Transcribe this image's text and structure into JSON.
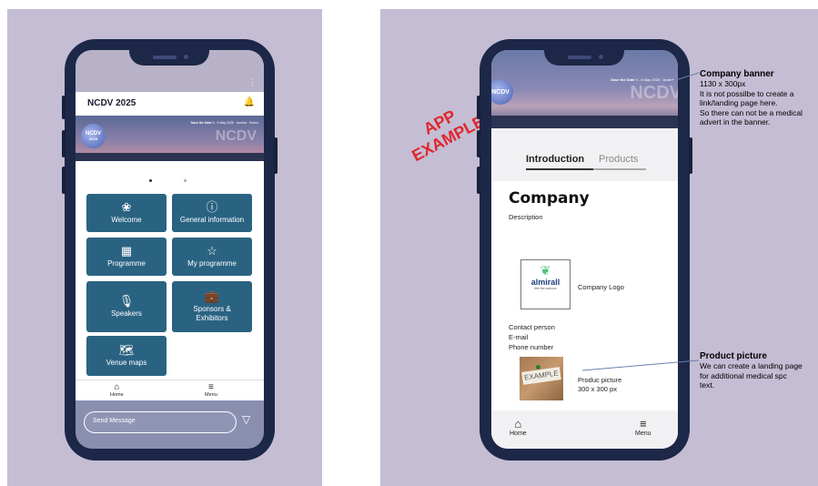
{
  "left_app": {
    "title": "NCDV 2025",
    "bell_icon": "bell-icon",
    "banner": {
      "logo_text": "NCDV",
      "logo_sub": "2025",
      "save_date": "Save the Date",
      "date_text": "5 - 8 May 2025 · Austria · Krems",
      "watermark": "NCDV"
    },
    "tiles": [
      {
        "label": "Welcome",
        "icon": "flower-icon"
      },
      {
        "label": "General information",
        "icon": "info-icon"
      },
      {
        "label": "Programme",
        "icon": "calendar-icon"
      },
      {
        "label": "My programme",
        "icon": "star-icon"
      },
      {
        "label": "Speakers",
        "icon": "microphone-icon"
      },
      {
        "label": "Sponsors &\nExhibitors",
        "icon": "briefcase-icon"
      },
      {
        "label": "Venue maps",
        "icon": "map-icon"
      }
    ],
    "nav": {
      "home": "Home",
      "menu": "Menu"
    },
    "message_placeholder": "Send Message"
  },
  "right_app": {
    "banner": {
      "logo_text": "NCDV",
      "save_date": "Save the Date",
      "date_text": "5 - 8 May 2025 · Austria",
      "watermark": "NCDV"
    },
    "tabs": {
      "introduction": "Introduction",
      "products": "Products"
    },
    "company_title": "Company",
    "description": "Description",
    "logo_brand": "almirall",
    "logo_tagline": "feel the science",
    "logo_label": "Company Logo",
    "contact": [
      "Contact person",
      "E-mail",
      "Phone number"
    ],
    "product_image_text": "EXAMPLE",
    "product_caption_1": "Produc picture",
    "product_caption_2": "300 x 300 px",
    "nav": {
      "home": "Home",
      "menu": "Menu"
    }
  },
  "stamp": {
    "line1": "APP",
    "line2": "EXAMPLE",
    "color": "#e0262b"
  },
  "annotations": {
    "banner_title": "Company banner",
    "banner_lines": [
      "1130 x 300px",
      "It is not possilbe to create a",
      "link/landing page here.",
      "So there can not be a medical",
      "advert in the banner."
    ],
    "product_title": "Product picture",
    "product_lines": [
      "We can create a landing page",
      "for additional medical spc",
      "text."
    ]
  },
  "colors": {
    "panel_bg": "#c4bdd4",
    "phone_frame": "#1d2748",
    "tile_bg": "#2a6382"
  }
}
